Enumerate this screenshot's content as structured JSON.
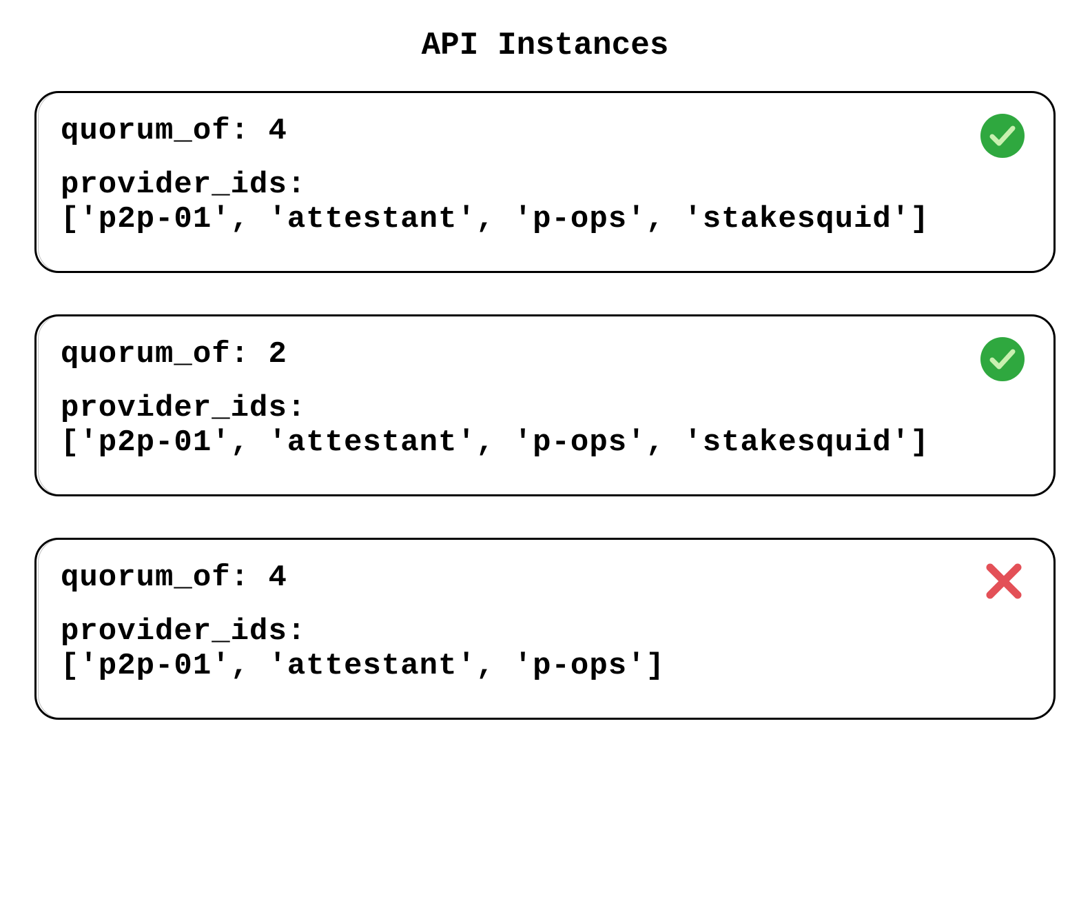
{
  "title": "API Instances",
  "labels": {
    "quorum_of": "quorum_of:",
    "provider_ids": "provider_ids:"
  },
  "instances": [
    {
      "quorum_of": 4,
      "provider_ids_display": "['p2p-01', 'attestant', 'p-ops', 'stakesquid']",
      "status": "ok"
    },
    {
      "quorum_of": 2,
      "provider_ids_display": "['p2p-01', 'attestant', 'p-ops', 'stakesquid']",
      "status": "ok"
    },
    {
      "quorum_of": 4,
      "provider_ids_display": "['p2p-01', 'attestant', 'p-ops']",
      "status": "error"
    }
  ],
  "icons": {
    "check": "check-circle-icon",
    "cross": "cross-icon"
  },
  "colors": {
    "ok": "#2fa83f",
    "error": "#e35057"
  }
}
